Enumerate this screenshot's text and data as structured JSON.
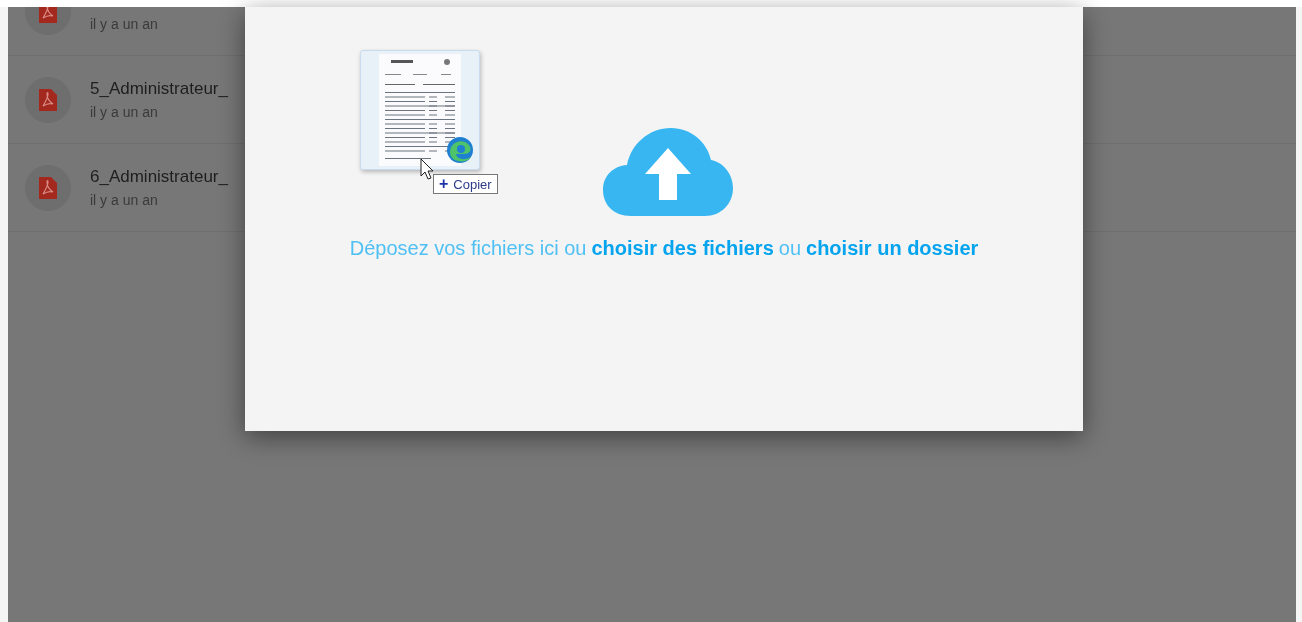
{
  "file_list": {
    "rows": [
      {
        "subtitle": "il y a un an"
      },
      {
        "title": "5_Administrateur_",
        "subtitle": "il y a un an"
      },
      {
        "title": "6_Administrateur_",
        "subtitle": "il y a un an"
      }
    ]
  },
  "upload_dialog": {
    "drop_text": [
      {
        "kind": "plain",
        "text": "Déposez vos fichiers ici ou"
      },
      {
        "kind": "link",
        "text": "choisir des fichiers"
      },
      {
        "kind": "plain",
        "text": "ou"
      },
      {
        "kind": "link",
        "text": "choisir un dossier"
      }
    ],
    "drag_preview": {
      "tooltip": {
        "icon": "+",
        "label": "Copier"
      }
    }
  }
}
